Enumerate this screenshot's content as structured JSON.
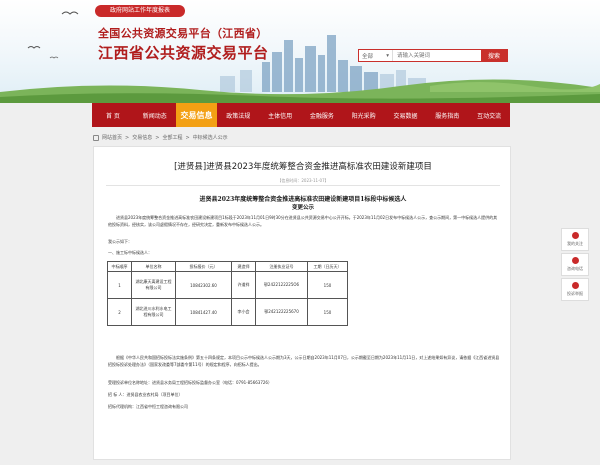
{
  "header": {
    "pill": "政府网站工作年度报表",
    "title_line1": "全国公共资源交易平台（江西省）",
    "title_line2": "江西省公共资源交易平台"
  },
  "search": {
    "scope": "全部",
    "placeholder": "请输入关键词",
    "button": "搜索"
  },
  "nav": {
    "items": [
      {
        "label": "首 页"
      },
      {
        "label": "新闻动态"
      },
      {
        "label": "交易信息"
      },
      {
        "label": "政策法规"
      },
      {
        "label": "主体信用"
      },
      {
        "label": "金融服务"
      },
      {
        "label": "阳光采购"
      },
      {
        "label": "交易数据"
      },
      {
        "label": "服务指南"
      },
      {
        "label": "互动交流"
      }
    ]
  },
  "breadcrumb": [
    "网站首页",
    "交易信息",
    "全部工程",
    "中标候选人公示"
  ],
  "article": {
    "title": "[进贤县]进贤县2023年度统筹整合资金推进高标准农田建设新建项目",
    "date": "【信息时间：2023-11-07】",
    "notice_title": "进贤县2023年度统筹整合资金推进高标准农田建设新建项目1标段中标候选人",
    "notice_subtitle": "变更公示",
    "intro": "进贤县2023年度统筹整合资金推进高标准农田建设新建项目1标段于2023年11月01日9时30分在进贤县公共资源交易中心公开开标。于2023年11月02日发布中标候选人公示，查公示期间，第一中标候选人提供的其他投标资料，经核实，该公司虚假情况不存在，经研究决定，重新发布中标候选人公示。",
    "greeting": "我公示如下：",
    "section": "一、施工标中标候选人：",
    "table": {
      "headers": [
        "中标顺序",
        "单位名称",
        "投标报价（元）",
        "建造师",
        "注册执业证号",
        "工期（日历天）"
      ],
      "rows": [
        {
          "rank": "1",
          "company": "湖北康天离建设工程有限公司",
          "price": "10842302.60",
          "builder": "许道祥",
          "cert": "鄂2422122225O6",
          "days": "150"
        },
        {
          "rank": "2",
          "company": "湖北进川水利水电工程有限公司",
          "price": "10841427.40",
          "builder": "李小会",
          "cert": "鄂242122225670",
          "days": "150"
        }
      ]
    },
    "legal": "根据《中华人民共和国招标投标法实施条例》第五十四条规定，本项目公示中标候选人公示期为3天，公示日期自2023年11月07日，公示期截至日期为2023年11月11日，对上述结果如有异议，请依据《江西省进贤县招投标投诉处理办法》（国家发改委等7部委令第11号）的规定和程序，向招标人提出。",
    "supervision": "受理投诉单位名称地址：进贤县水务局工程招标投标监督办公室（电话：0791-85663726）",
    "tenderer": "招 标 人：进贤县农业农村局（项目单位）",
    "agent": "招标代理机构：江西省中恒工程咨询有限公司"
  },
  "float_menu": [
    {
      "label": "我的关注"
    },
    {
      "label": "咨询电话"
    },
    {
      "label": "投诉举报"
    }
  ]
}
